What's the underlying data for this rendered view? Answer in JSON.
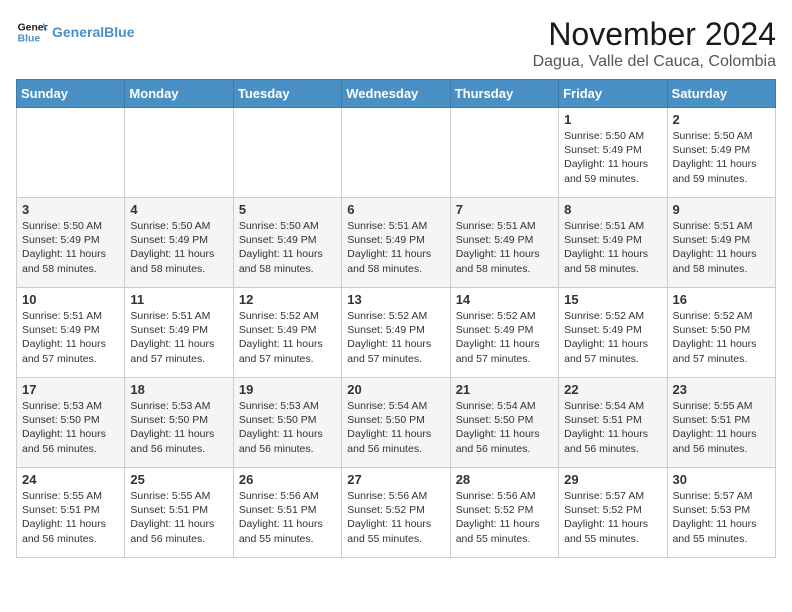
{
  "logo": {
    "line1": "General",
    "line2": "Blue"
  },
  "title": "November 2024",
  "location": "Dagua, Valle del Cauca, Colombia",
  "days_of_week": [
    "Sunday",
    "Monday",
    "Tuesday",
    "Wednesday",
    "Thursday",
    "Friday",
    "Saturday"
  ],
  "weeks": [
    [
      {
        "day": "",
        "info": ""
      },
      {
        "day": "",
        "info": ""
      },
      {
        "day": "",
        "info": ""
      },
      {
        "day": "",
        "info": ""
      },
      {
        "day": "",
        "info": ""
      },
      {
        "day": "1",
        "info": "Sunrise: 5:50 AM\nSunset: 5:49 PM\nDaylight: 11 hours and 59 minutes."
      },
      {
        "day": "2",
        "info": "Sunrise: 5:50 AM\nSunset: 5:49 PM\nDaylight: 11 hours and 59 minutes."
      }
    ],
    [
      {
        "day": "3",
        "info": "Sunrise: 5:50 AM\nSunset: 5:49 PM\nDaylight: 11 hours and 58 minutes."
      },
      {
        "day": "4",
        "info": "Sunrise: 5:50 AM\nSunset: 5:49 PM\nDaylight: 11 hours and 58 minutes."
      },
      {
        "day": "5",
        "info": "Sunrise: 5:50 AM\nSunset: 5:49 PM\nDaylight: 11 hours and 58 minutes."
      },
      {
        "day": "6",
        "info": "Sunrise: 5:51 AM\nSunset: 5:49 PM\nDaylight: 11 hours and 58 minutes."
      },
      {
        "day": "7",
        "info": "Sunrise: 5:51 AM\nSunset: 5:49 PM\nDaylight: 11 hours and 58 minutes."
      },
      {
        "day": "8",
        "info": "Sunrise: 5:51 AM\nSunset: 5:49 PM\nDaylight: 11 hours and 58 minutes."
      },
      {
        "day": "9",
        "info": "Sunrise: 5:51 AM\nSunset: 5:49 PM\nDaylight: 11 hours and 58 minutes."
      }
    ],
    [
      {
        "day": "10",
        "info": "Sunrise: 5:51 AM\nSunset: 5:49 PM\nDaylight: 11 hours and 57 minutes."
      },
      {
        "day": "11",
        "info": "Sunrise: 5:51 AM\nSunset: 5:49 PM\nDaylight: 11 hours and 57 minutes."
      },
      {
        "day": "12",
        "info": "Sunrise: 5:52 AM\nSunset: 5:49 PM\nDaylight: 11 hours and 57 minutes."
      },
      {
        "day": "13",
        "info": "Sunrise: 5:52 AM\nSunset: 5:49 PM\nDaylight: 11 hours and 57 minutes."
      },
      {
        "day": "14",
        "info": "Sunrise: 5:52 AM\nSunset: 5:49 PM\nDaylight: 11 hours and 57 minutes."
      },
      {
        "day": "15",
        "info": "Sunrise: 5:52 AM\nSunset: 5:49 PM\nDaylight: 11 hours and 57 minutes."
      },
      {
        "day": "16",
        "info": "Sunrise: 5:52 AM\nSunset: 5:50 PM\nDaylight: 11 hours and 57 minutes."
      }
    ],
    [
      {
        "day": "17",
        "info": "Sunrise: 5:53 AM\nSunset: 5:50 PM\nDaylight: 11 hours and 56 minutes."
      },
      {
        "day": "18",
        "info": "Sunrise: 5:53 AM\nSunset: 5:50 PM\nDaylight: 11 hours and 56 minutes."
      },
      {
        "day": "19",
        "info": "Sunrise: 5:53 AM\nSunset: 5:50 PM\nDaylight: 11 hours and 56 minutes."
      },
      {
        "day": "20",
        "info": "Sunrise: 5:54 AM\nSunset: 5:50 PM\nDaylight: 11 hours and 56 minutes."
      },
      {
        "day": "21",
        "info": "Sunrise: 5:54 AM\nSunset: 5:50 PM\nDaylight: 11 hours and 56 minutes."
      },
      {
        "day": "22",
        "info": "Sunrise: 5:54 AM\nSunset: 5:51 PM\nDaylight: 11 hours and 56 minutes."
      },
      {
        "day": "23",
        "info": "Sunrise: 5:55 AM\nSunset: 5:51 PM\nDaylight: 11 hours and 56 minutes."
      }
    ],
    [
      {
        "day": "24",
        "info": "Sunrise: 5:55 AM\nSunset: 5:51 PM\nDaylight: 11 hours and 56 minutes."
      },
      {
        "day": "25",
        "info": "Sunrise: 5:55 AM\nSunset: 5:51 PM\nDaylight: 11 hours and 56 minutes."
      },
      {
        "day": "26",
        "info": "Sunrise: 5:56 AM\nSunset: 5:51 PM\nDaylight: 11 hours and 55 minutes."
      },
      {
        "day": "27",
        "info": "Sunrise: 5:56 AM\nSunset: 5:52 PM\nDaylight: 11 hours and 55 minutes."
      },
      {
        "day": "28",
        "info": "Sunrise: 5:56 AM\nSunset: 5:52 PM\nDaylight: 11 hours and 55 minutes."
      },
      {
        "day": "29",
        "info": "Sunrise: 5:57 AM\nSunset: 5:52 PM\nDaylight: 11 hours and 55 minutes."
      },
      {
        "day": "30",
        "info": "Sunrise: 5:57 AM\nSunset: 5:53 PM\nDaylight: 11 hours and 55 minutes."
      }
    ]
  ]
}
